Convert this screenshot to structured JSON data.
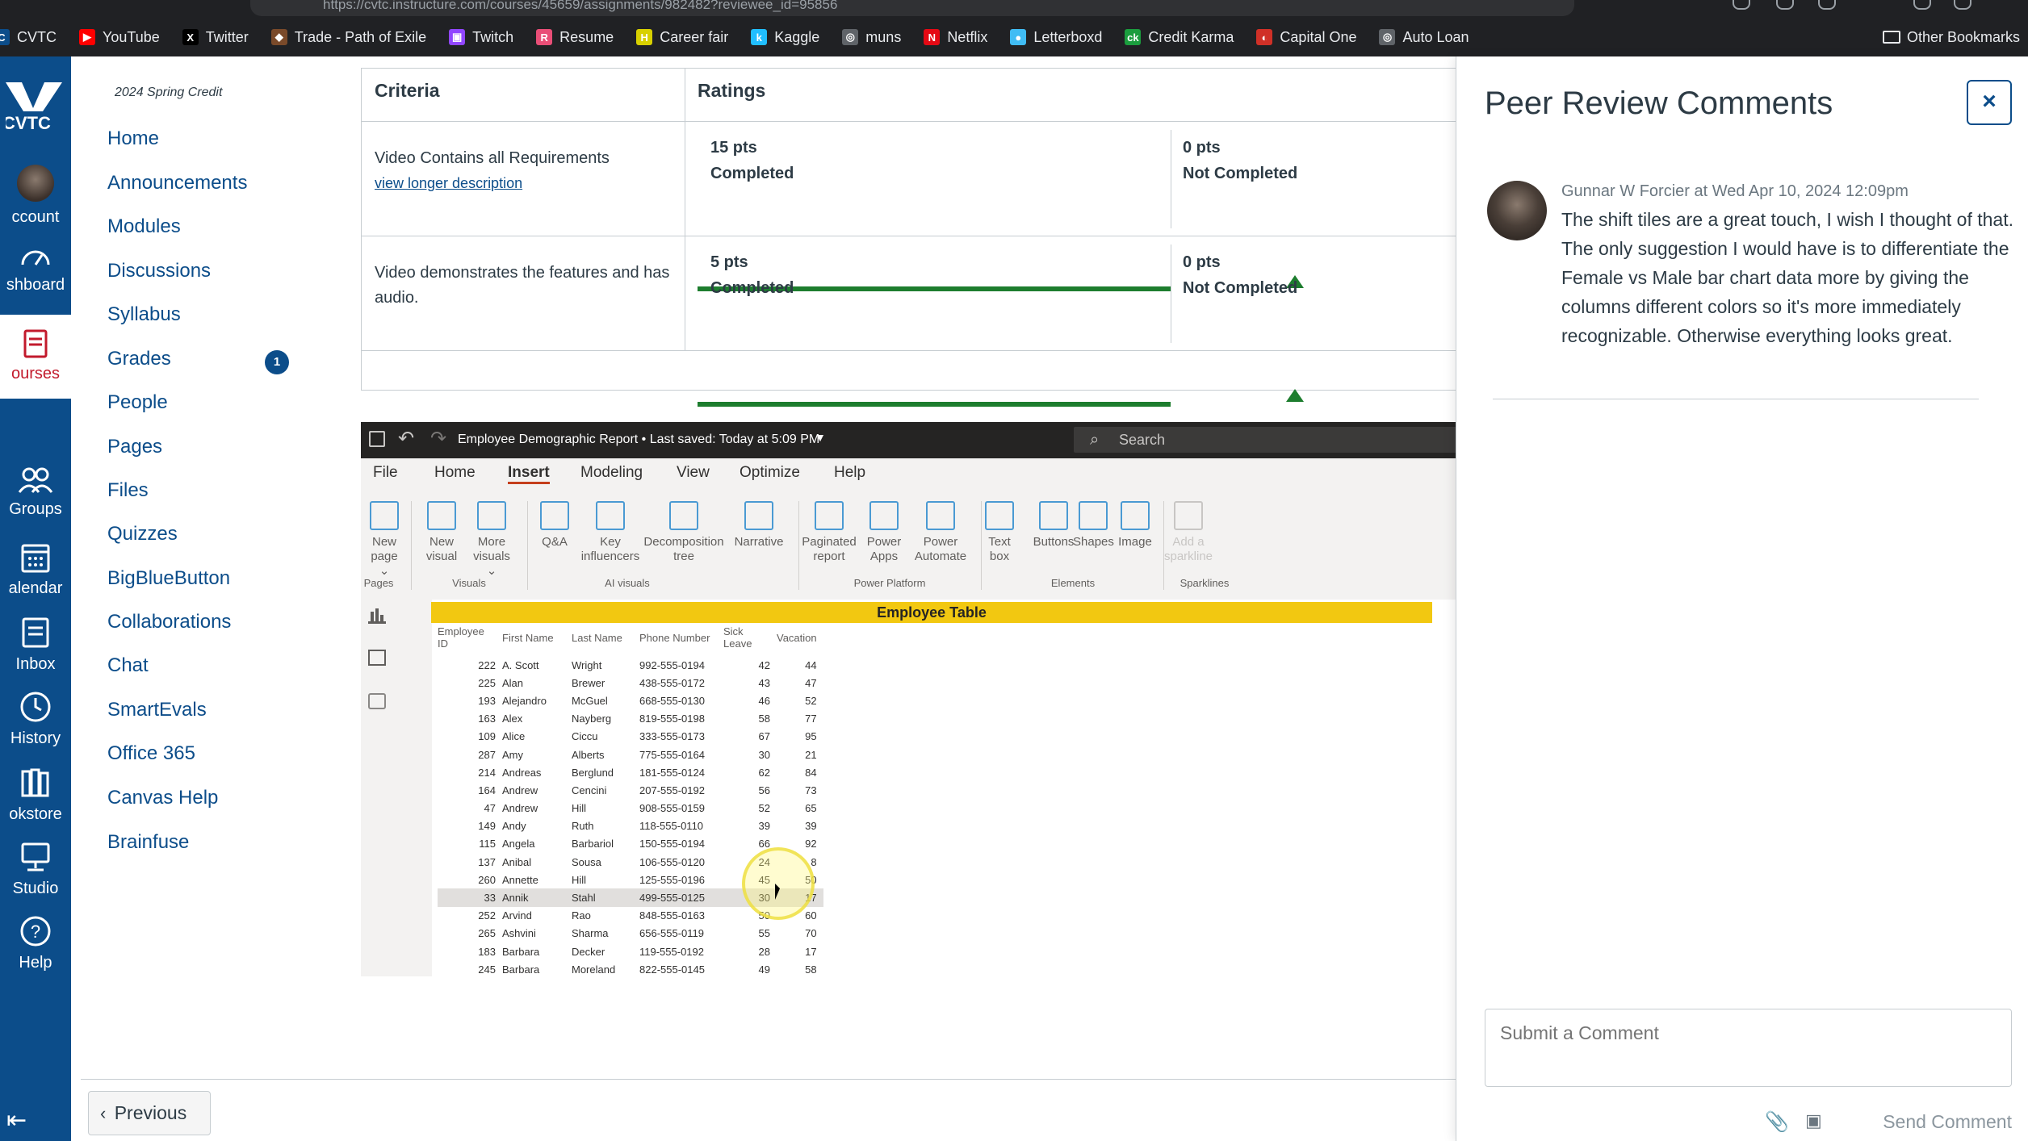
{
  "browser": {
    "url": "https://cvtc.instructure.com/courses/45659/assignments/982482?reviewee_id=95856",
    "bookmarks": [
      {
        "label": "CVTC",
        "color": "#0c4d8a",
        "glyph": "C"
      },
      {
        "label": "YouTube",
        "color": "#ff0000",
        "glyph": "▶"
      },
      {
        "label": "Twitter",
        "color": "#000000",
        "glyph": "X"
      },
      {
        "label": "Trade - Path of Exile",
        "color": "#7a4a2a",
        "glyph": "◆"
      },
      {
        "label": "Twitch",
        "color": "#9146ff",
        "glyph": "▣"
      },
      {
        "label": "Resume",
        "color": "#e94e77",
        "glyph": "R"
      },
      {
        "label": "Career fair",
        "color": "#d8d000",
        "glyph": "H"
      },
      {
        "label": "Kaggle",
        "color": "#20beff",
        "glyph": "k"
      },
      {
        "label": "muns",
        "color": "#5f6368",
        "glyph": "◎"
      },
      {
        "label": "Netflix",
        "color": "#e50914",
        "glyph": "N"
      },
      {
        "label": "Letterboxd",
        "color": "#40bcf4",
        "glyph": "●"
      },
      {
        "label": "Credit Karma",
        "color": "#1b9d3e",
        "glyph": "ck"
      },
      {
        "label": "Capital One",
        "color": "#d03027",
        "glyph": "◐"
      },
      {
        "label": "Auto Loan",
        "color": "#5f6368",
        "glyph": "◎"
      }
    ],
    "other_bookmarks": "Other Bookmarks"
  },
  "global_nav": {
    "logo": "CVTC",
    "items": [
      {
        "label": "Account",
        "icon": "account-avatar"
      },
      {
        "label": "Dashboard",
        "icon": "dashboard-icon"
      },
      {
        "label": "Courses",
        "icon": "courses-icon"
      },
      {
        "label": "Groups",
        "icon": "groups-icon"
      },
      {
        "label": "Calendar",
        "icon": "calendar-icon"
      },
      {
        "label": "Inbox",
        "icon": "inbox-icon"
      },
      {
        "label": "History",
        "icon": "history-icon"
      },
      {
        "label": "Bookstore",
        "icon": "bookstore-icon"
      },
      {
        "label": "Studio",
        "icon": "studio-icon"
      },
      {
        "label": "Help",
        "icon": "help-icon"
      }
    ],
    "visible_labels": [
      "ccount",
      "shboard",
      "ourses",
      "Groups",
      "alendar",
      "Inbox",
      "History",
      "okstore",
      "Studio",
      "Help"
    ]
  },
  "course_nav": {
    "term": "2024 Spring Credit",
    "items": [
      "Home",
      "Announcements",
      "Modules",
      "Discussions",
      "Syllabus",
      "Grades",
      "People",
      "Pages",
      "Files",
      "Quizzes",
      "BigBlueButton",
      "Collaborations",
      "Chat",
      "SmartEvals",
      "Office 365",
      "Canvas Help",
      "Brainfuse"
    ],
    "grades_badge": "1"
  },
  "rubric": {
    "criteria_header": "Criteria",
    "ratings_header": "Ratings",
    "rows": [
      {
        "criterion": "Video Contains all Requirements",
        "link": "view longer description",
        "rating_selected_pts": "15 pts",
        "rating_selected_label": "Completed",
        "rating_other_pts": "0 pts",
        "rating_other_label": "Not Completed"
      },
      {
        "criterion": "Video demonstrates the features and has audio.",
        "rating_selected_pts": "5 pts",
        "rating_selected_label": "Completed",
        "rating_other_pts": "0 pts",
        "rating_other_label": "Not Completed"
      }
    ]
  },
  "powerbi": {
    "title": "Employee Demographic Report • Last saved: Today at 5:09 PM",
    "search": "Search",
    "menus": [
      "File",
      "Home",
      "Insert",
      "Modeling",
      "View",
      "Optimize",
      "Help"
    ],
    "active_menu": "Insert",
    "ribbon": [
      {
        "label": "New page",
        "sub": "⌄"
      },
      {
        "label": "New visual"
      },
      {
        "label": "More visuals",
        "sub": "⌄"
      },
      {
        "label": "Q&A"
      },
      {
        "label": "Key influencers"
      },
      {
        "label": "Decomposition tree"
      },
      {
        "label": "Narrative"
      },
      {
        "label": "Paginated report"
      },
      {
        "label": "Power Apps"
      },
      {
        "label": "Power Automate"
      },
      {
        "label": "Text box"
      },
      {
        "label": "Buttons"
      },
      {
        "label": "Shapes"
      },
      {
        "label": "Image"
      },
      {
        "label": "Add a sparkline"
      }
    ],
    "groups": [
      "Pages",
      "Visuals",
      "AI visuals",
      "Power Platform",
      "Elements",
      "Sparklines"
    ],
    "table_title": "Employee Table",
    "columns": [
      "Employee ID",
      "First Name",
      "Last Name",
      "Phone Number",
      "Sick Leave",
      "Vacation"
    ],
    "rows": [
      [
        "222",
        "A. Scott",
        "Wright",
        "992-555-0194",
        "42",
        "44"
      ],
      [
        "225",
        "Alan",
        "Brewer",
        "438-555-0172",
        "43",
        "47"
      ],
      [
        "193",
        "Alejandro",
        "McGuel",
        "668-555-0130",
        "46",
        "52"
      ],
      [
        "163",
        "Alex",
        "Nayberg",
        "819-555-0198",
        "58",
        "77"
      ],
      [
        "109",
        "Alice",
        "Ciccu",
        "333-555-0173",
        "67",
        "95"
      ],
      [
        "287",
        "Amy",
        "Alberts",
        "775-555-0164",
        "30",
        "21"
      ],
      [
        "214",
        "Andreas",
        "Berglund",
        "181-555-0124",
        "62",
        "84"
      ],
      [
        "164",
        "Andrew",
        "Cencini",
        "207-555-0192",
        "56",
        "73"
      ],
      [
        "47",
        "Andrew",
        "Hill",
        "908-555-0159",
        "52",
        "65"
      ],
      [
        "149",
        "Andy",
        "Ruth",
        "118-555-0110",
        "39",
        "39"
      ],
      [
        "115",
        "Angela",
        "Barbariol",
        "150-555-0194",
        "66",
        "92"
      ],
      [
        "137",
        "Anibal",
        "Sousa",
        "106-555-0120",
        "24",
        "8"
      ],
      [
        "260",
        "Annette",
        "Hill",
        "125-555-0196",
        "45",
        "50"
      ],
      [
        "33",
        "Annik",
        "Stahl",
        "499-555-0125",
        "30",
        "17"
      ],
      [
        "252",
        "Arvind",
        "Rao",
        "848-555-0163",
        "50",
        "60"
      ],
      [
        "265",
        "Ashvini",
        "Sharma",
        "656-555-0119",
        "55",
        "70"
      ],
      [
        "183",
        "Barbara",
        "Decker",
        "119-555-0192",
        "28",
        "17"
      ],
      [
        "245",
        "Barbara",
        "Moreland",
        "822-555-0145",
        "49",
        "58"
      ]
    ]
  },
  "footer": {
    "previous": "Previous"
  },
  "tray": {
    "title": "Peer Review Comments",
    "close": "×",
    "author": "Gunnar W Forcier at Wed Apr 10, 2024 12:09pm",
    "comment": "The shift tiles are a great touch, I wish I thought of that. The only suggestion I would have is to differentiate the Female vs Male bar chart data more by giving the columns different colors so it's more immediately recognizable. Otherwise everything looks great.",
    "placeholder": "Submit a Comment",
    "send": "Send Comment"
  },
  "colors": {
    "brand": "#0c4d8a",
    "rating": "#1d7d2e",
    "pbi_yellow": "#f2c811"
  }
}
